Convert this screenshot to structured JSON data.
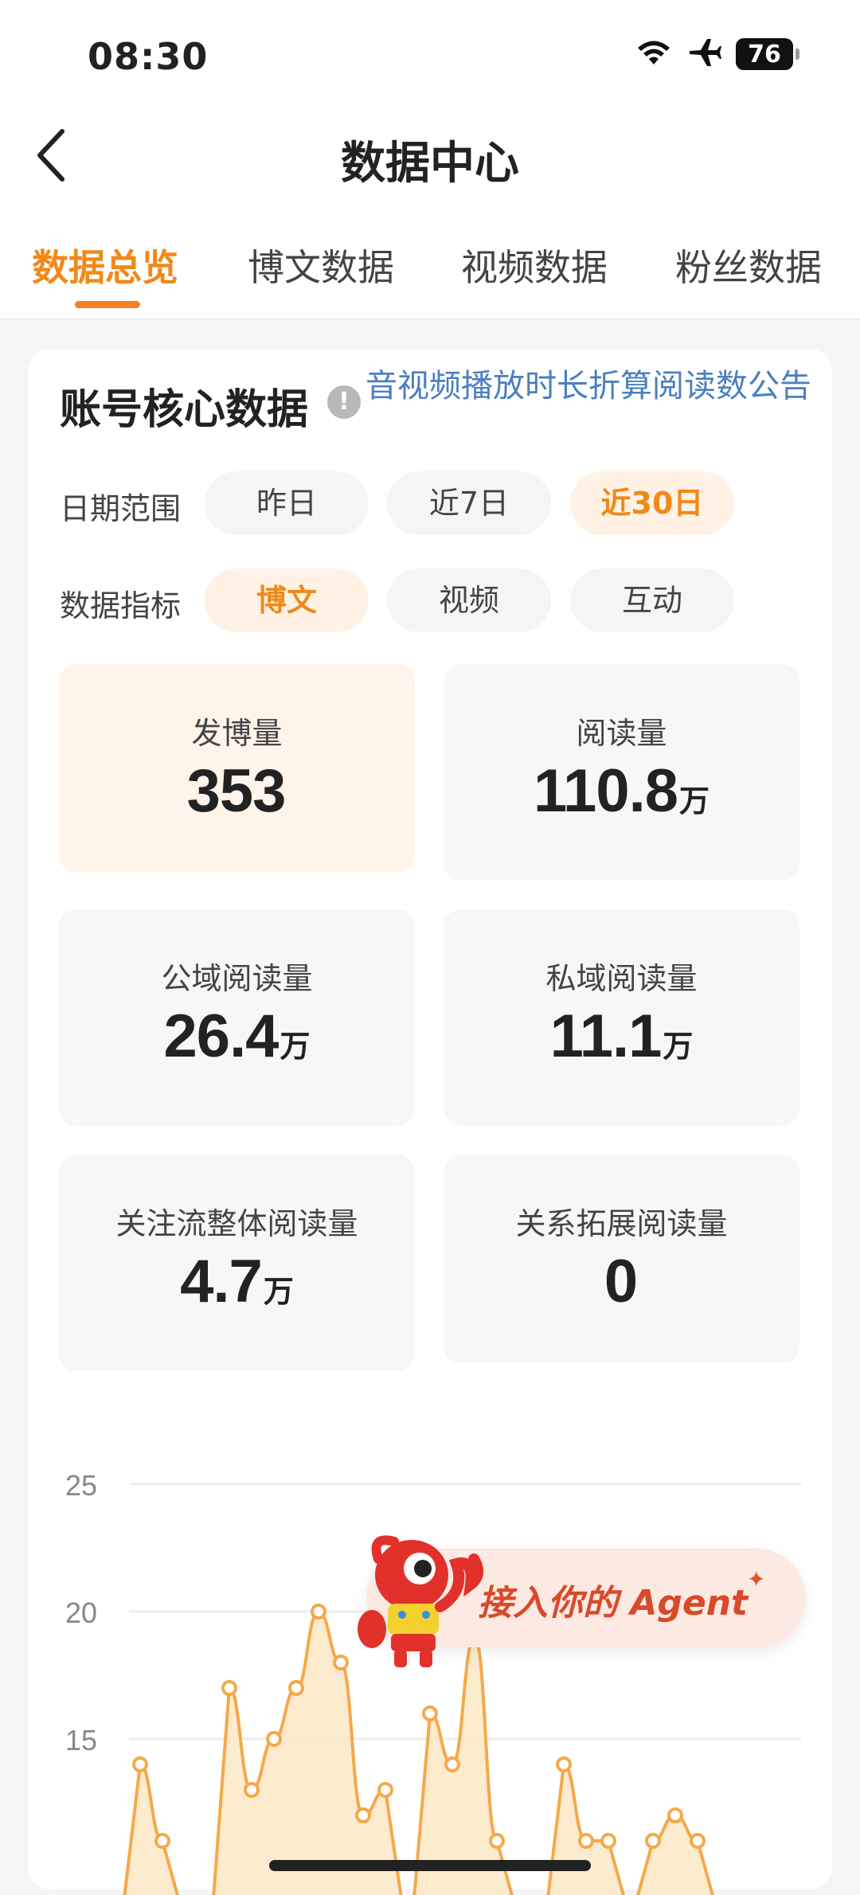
{
  "status_bar": {
    "time": "08:30",
    "battery": "76"
  },
  "header": {
    "title": "数据中心"
  },
  "tabs": [
    {
      "label": "数据总览",
      "active": true
    },
    {
      "label": "博文数据",
      "active": false
    },
    {
      "label": "视频数据",
      "active": false
    },
    {
      "label": "粉丝数据",
      "active": false
    }
  ],
  "core": {
    "title": "账号核心数据",
    "notice_link": "音视频播放时长折算阅读数公告",
    "date_range": {
      "label": "日期范围",
      "options": [
        "昨日",
        "近7日",
        "近30日"
      ],
      "selected": "近30日"
    },
    "metric_type": {
      "label": "数据指标",
      "options": [
        "博文",
        "视频",
        "互动"
      ],
      "selected": "博文"
    },
    "metrics": [
      {
        "label": "发博量",
        "value": "353",
        "unit": ""
      },
      {
        "label": "阅读量",
        "value": "110.8",
        "unit": "万"
      },
      {
        "label": "公域阅读量",
        "value": "26.4",
        "unit": "万"
      },
      {
        "label": "私域阅读量",
        "value": "11.1",
        "unit": "万"
      },
      {
        "label": "关注流整体阅读量",
        "value": "4.7",
        "unit": "万"
      },
      {
        "label": "关系拓展阅读量",
        "value": "0",
        "unit": ""
      }
    ]
  },
  "chart_data": {
    "type": "area",
    "y_ticks": [
      15,
      20,
      25
    ],
    "ylim": [
      10,
      25
    ],
    "grid": true,
    "color": "#f5a94a",
    "fill": "#fde7c6",
    "values": [
      null,
      14,
      11,
      null,
      null,
      17,
      13,
      15,
      17,
      20,
      18,
      12,
      13,
      null,
      16,
      14,
      19,
      11,
      null,
      null,
      14,
      11,
      11,
      null,
      11,
      12,
      11
    ]
  },
  "agent_banner": {
    "text": "接入你的 Agent"
  }
}
